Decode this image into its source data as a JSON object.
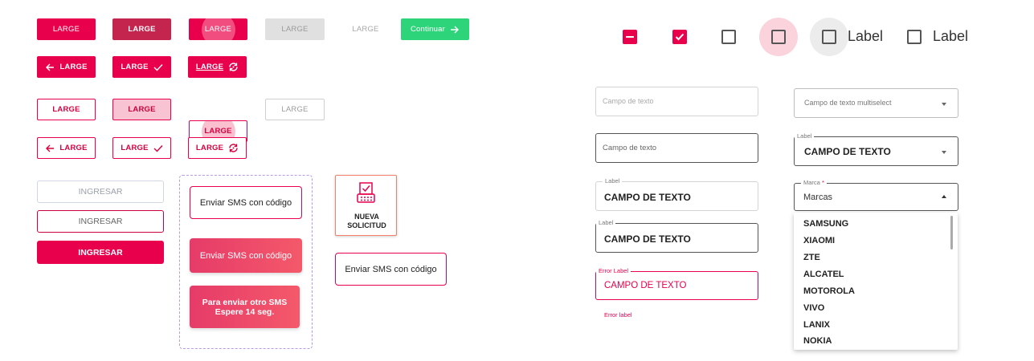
{
  "buttons": {
    "large": "LARGE",
    "continue": "Continuar"
  },
  "ingresar": {
    "label": "INGRESAR"
  },
  "sms": {
    "send": "Enviar SMS con código",
    "wait_line1": "Para enviar otro SMS",
    "wait_line2": "Espere 14 seg."
  },
  "nueva_solicitud": {
    "line1": "NUEVA",
    "line2": "SOLICITUD"
  },
  "checkboxes": {
    "label": "Label"
  },
  "fields": {
    "placeholder": "Campo de texto",
    "multiselect_placeholder": "Campo de texto multiselect",
    "label": "Label",
    "value": "CAMPO DE TEXTO",
    "error_label": "Error Label",
    "error_value": "CAMPO DE TEXTO",
    "error_helper": "Error label",
    "marca_label": "Marca",
    "marca_required": "*",
    "marca_value": "Marcas"
  },
  "dropdown": {
    "options": [
      "SAMSUNG",
      "XIAOMI",
      "ZTE",
      "ALCATEL",
      "MOTOROLA",
      "VIVO",
      "LANIX",
      "NOKIA"
    ]
  },
  "colors": {
    "primary": "#e8004c",
    "primary_dark": "#c4254f",
    "success": "#2ed47a",
    "dashed_border": "#b79be6"
  }
}
